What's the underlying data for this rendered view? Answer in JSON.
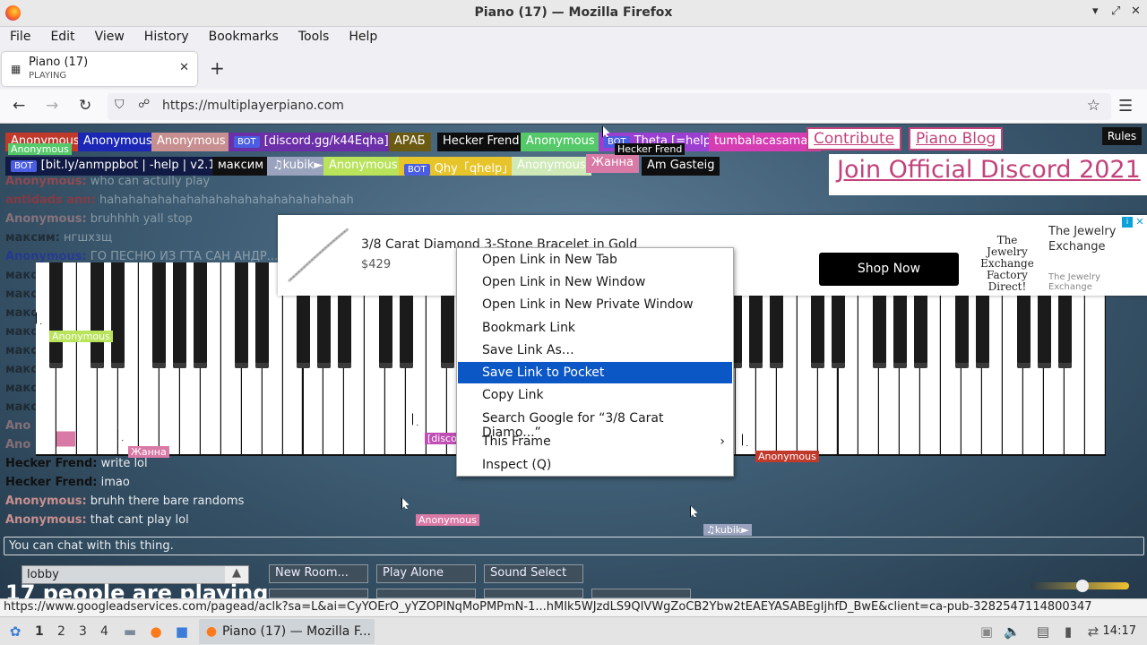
{
  "window": {
    "title": "Piano (17) — Mozilla Firefox",
    "minimize": "▾",
    "maximize": "⤢",
    "close": "✕"
  },
  "menubar": [
    "File",
    "Edit",
    "View",
    "History",
    "Bookmarks",
    "Tools",
    "Help"
  ],
  "tab": {
    "title": "Piano (17)",
    "subtitle": "PLAYING",
    "close": "✕",
    "new": "+"
  },
  "nav": {
    "url": "https://multiplayerpiano.com",
    "back": "←",
    "forward": "→",
    "reload": "↻",
    "shield": "⛉",
    "lock": "🔒",
    "star": "☆",
    "menu": "☰"
  },
  "participants": [
    {
      "name": "Anonymous",
      "bg": "#c0392b",
      "color": "#fff",
      "bot": false
    },
    {
      "name": "Anonymous",
      "bg": "#1a28b5",
      "color": "#fff",
      "bot": false
    },
    {
      "name": "Anonymous",
      "bg": "#c78f8f",
      "color": "#fff",
      "bot": false
    },
    {
      "name": "[discord.gg/k44Eqha]",
      "bg": "#6b2fa8",
      "color": "#fff",
      "bot": true
    },
    {
      "name": "АРАБ",
      "bg": "#6b5a12",
      "color": "#fff",
      "bot": false
    },
    {
      "name": "Hecker Frend",
      "bg": "#0d0d0d",
      "color": "#fff",
      "bot": false
    },
    {
      "name": "Anonymous",
      "bg": "#55c96a",
      "color": "#fff",
      "bot": false
    },
    {
      "name": "Theta [=help]",
      "bg": "#9b3fd0",
      "color": "#fff",
      "bot": true
    },
    {
      "name": "tumbalacasaman",
      "bg": "#d53db3",
      "color": "#fff",
      "bot": false
    },
    {
      "name": "[bit.ly/anmppbot | -help | v2.1]",
      "bg": "#111a44",
      "color": "#fff",
      "bot": true
    },
    {
      "name": "максим",
      "bg": "#101010",
      "color": "#fff",
      "bot": false
    },
    {
      "name": "♫kubik►",
      "bg": "#9aa3bd",
      "color": "#fff",
      "bot": false
    },
    {
      "name": "Anonymous",
      "bg": "#b8e35a",
      "color": "#fff",
      "bot": false
    },
    {
      "name": "Qhy「qhelp」",
      "bg": "#e6c42a",
      "color": "#fff",
      "bot": true
    },
    {
      "name": "Anonymous",
      "bg": "#cfe9b8",
      "color": "#fff",
      "bot": false
    },
    {
      "name": "Жанна",
      "bg": "#d97aa6",
      "color": "#fff",
      "bot": false
    },
    {
      "name": "Am Gasteig",
      "bg": "#0e0e0e",
      "color": "#fff",
      "bot": false
    }
  ],
  "botlabel": "BOT",
  "links": {
    "contribute": "Contribute",
    "blog": "Piano Blog",
    "discord": "Join Official Discord 2021",
    "rules": "Rules"
  },
  "chat": [
    {
      "name": "Anonymous:",
      "text": "who can actully play",
      "color": "#d84545"
    },
    {
      "name": "antidads ann:",
      "text": "hahahahahahahahahahahahahahahahahah",
      "color": "#c42a2a"
    },
    {
      "name": "Anonymous:",
      "text": "bruhhhh yall stop",
      "color": "#c78f8f"
    },
    {
      "name": "максим:",
      "text": "нгшхзщ",
      "color": "#111"
    },
    {
      "name": "Anonymous:",
      "text": "ГО ПЕСНЮ ИЗ ГТА САН АНДР...",
      "color": "#1a28b5"
    },
    {
      "name": "макс",
      "text": "",
      "color": "#111"
    },
    {
      "name": "макс",
      "text": "",
      "color": "#111"
    },
    {
      "name": "макс",
      "text": "",
      "color": "#111"
    },
    {
      "name": "макс",
      "text": "",
      "color": "#111"
    },
    {
      "name": "макс",
      "text": "",
      "color": "#111"
    },
    {
      "name": "макс",
      "text": "",
      "color": "#111"
    },
    {
      "name": "макс",
      "text": "",
      "color": "#111"
    },
    {
      "name": "макс",
      "text": "",
      "color": "#111"
    },
    {
      "name": "Ano",
      "text": "",
      "color": "#c78f8f"
    },
    {
      "name": "Ano",
      "text": "",
      "color": "#c78f8f"
    },
    {
      "name": "Hecker Frend:",
      "text": "write lol",
      "color": "#111"
    },
    {
      "name": "Hecker Frend:",
      "text": "imao",
      "color": "#111"
    },
    {
      "name": "Anonymous:",
      "text": "bruhh there bare randoms",
      "color": "#c78f8f"
    },
    {
      "name": "Anonymous:",
      "text": "that cant play lol",
      "color": "#c78f8f"
    }
  ],
  "ad": {
    "title": "3/8 Carat Diamond 3-Stone Bracelet in Gold",
    "price": "$429",
    "cta": "Shop Now",
    "logo": "The Jewelry Exchange Factory Direct!",
    "brand1": "The Jewelry",
    "brand2": "Exchange",
    "sub": "The Jewelry Exchange",
    "info": "i",
    "close": "✕"
  },
  "context_menu": [
    {
      "label": "Open Link in New Tab",
      "selected": false
    },
    {
      "label": "Open Link in New Window",
      "selected": false
    },
    {
      "label": "Open Link in New Private Window",
      "selected": false
    },
    {
      "label": "Bookmark Link",
      "selected": false
    },
    {
      "label": "Save Link As…",
      "selected": false
    },
    {
      "label": "Save Link to Pocket",
      "selected": true
    },
    {
      "label": "Copy Link",
      "selected": false
    },
    {
      "label": "Search Google for “3/8 Carat Diamo...”",
      "selected": false
    },
    {
      "label": "This Frame",
      "selected": false,
      "submenu": "›"
    },
    {
      "label": "Inspect (Q)",
      "selected": false
    }
  ],
  "piano_tags": [
    {
      "name": "Anonymous",
      "bg": "#55c96a"
    },
    {
      "name": "Hecker Frend",
      "bg": "#0d0d0d"
    },
    {
      "name": "Anonymous",
      "bg": "#b8e35a"
    },
    {
      "name": "Жанна",
      "bg": "#d97aa6"
    },
    {
      "name": "[discor",
      "bg": "#c04fb4"
    },
    {
      "name": "Anonymous",
      "bg": "#c0392b"
    },
    {
      "name": "Anonymous",
      "bg": "#d97aa6"
    },
    {
      "name": "♫kubik►",
      "bg": "#9aa3bd"
    }
  ],
  "chat_input": {
    "placeholder": "You can chat with this thing."
  },
  "controls": {
    "room": "lobby",
    "new_room": "New Room...",
    "play_alone": "Play Alone",
    "sound_select": "Sound Select",
    "people": "17 people are playing"
  },
  "status_url": "https://www.googleadservices.com/pagead/aclk?sa=L&ai=CyYOErO_yYZOPINqMoPMPmN-1...hMIk5WJzdLS9QIVWgZoCB2Ybw2tEAEYASABEgIjhfD_BwE&client=ca-pub-3282547114800347",
  "taskbar": {
    "workspaces": [
      "1",
      "2",
      "3",
      "4"
    ],
    "task": "Piano (17) — Mozilla F...",
    "clock": "14:17"
  }
}
